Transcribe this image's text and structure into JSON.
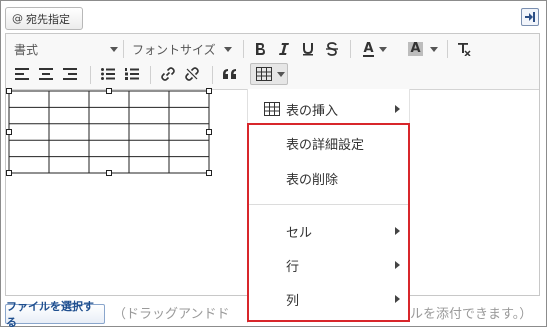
{
  "mention": {
    "icon": "at-icon",
    "at_symbol": "@",
    "label": "宛先指定"
  },
  "toolbar": {
    "format_select": "書式",
    "font_size_select": "フォントサイズ",
    "color_text_label": "A",
    "bg_color_label": "A",
    "accent_red": "#d8262b"
  },
  "menu": {
    "insert_table": "表の挿入",
    "table_details": "表の詳細設定",
    "delete_table": "表の削除",
    "cell": "セル",
    "row": "行",
    "column": "列"
  },
  "footer": {
    "select_file_button": "ファイルを選択する",
    "drop_hint_start": "（ドラッグアンドド",
    "drop_hint_end": "ルを添付できます。）"
  }
}
